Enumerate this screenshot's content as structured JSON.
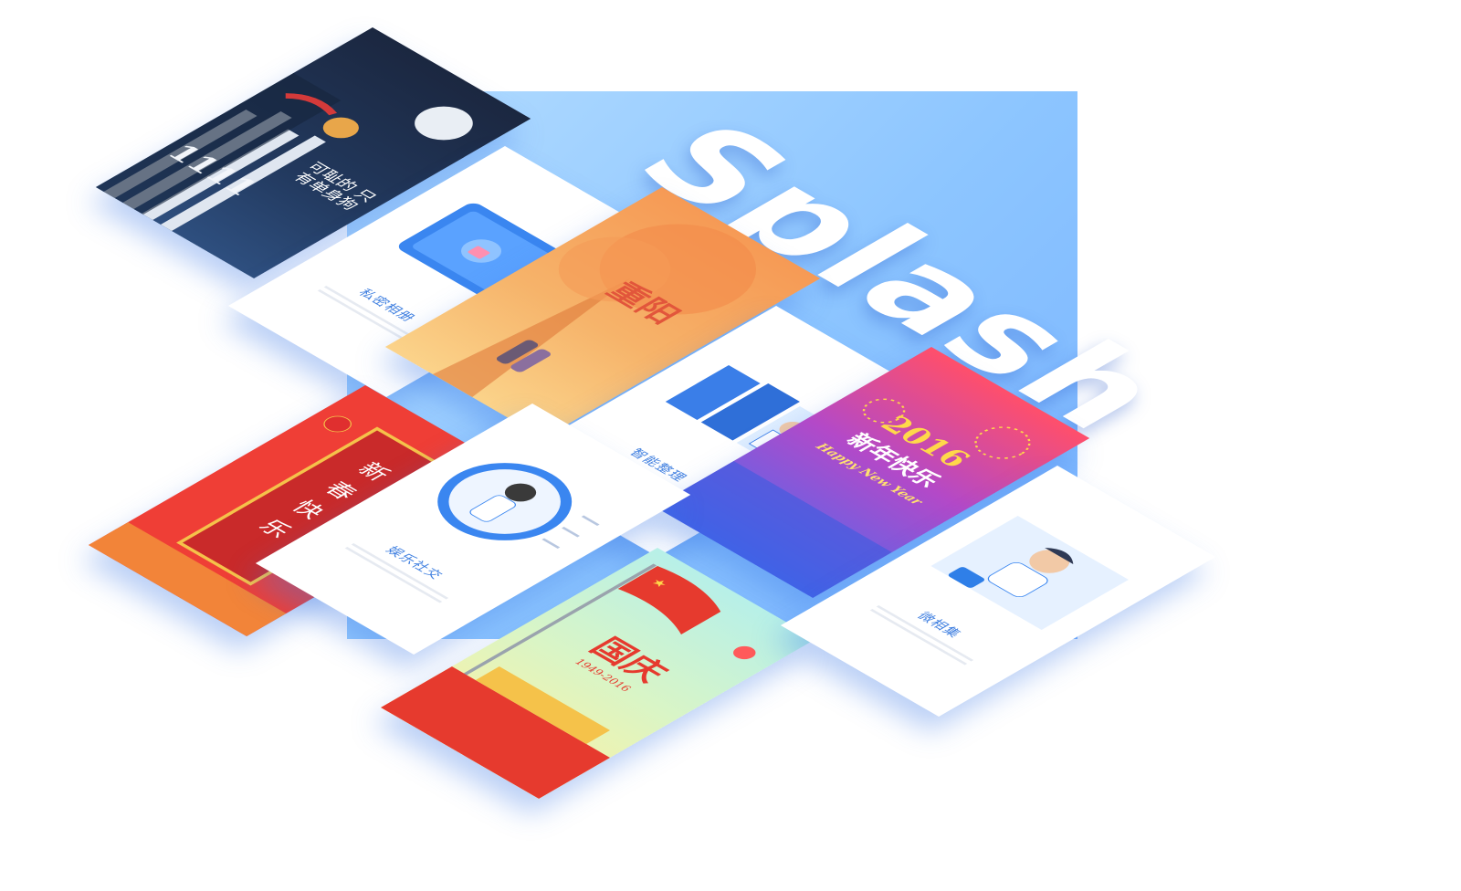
{
  "title": "Splash",
  "cards": {
    "album": {
      "label": "私密相册"
    },
    "double_ninth": {
      "text": "重阳"
    },
    "organize": {
      "label": "智能整理",
      "tags": [
        "",
        "",
        ""
      ]
    },
    "new_year": {
      "year": "2016",
      "text": "新年快乐",
      "english": "Happy New Year"
    },
    "singles_day": {
      "number": "1111",
      "slogan": "可耻的 只有单身狗"
    },
    "spring": {
      "text": "新春快乐"
    },
    "social": {
      "label": "娱乐社交"
    },
    "national": {
      "text": "国庆",
      "years": "1949-2016"
    },
    "micro_album": {
      "label": "微相集"
    }
  },
  "colors": {
    "panel": "#8cc5ff",
    "accent": "#3f7fe0"
  }
}
